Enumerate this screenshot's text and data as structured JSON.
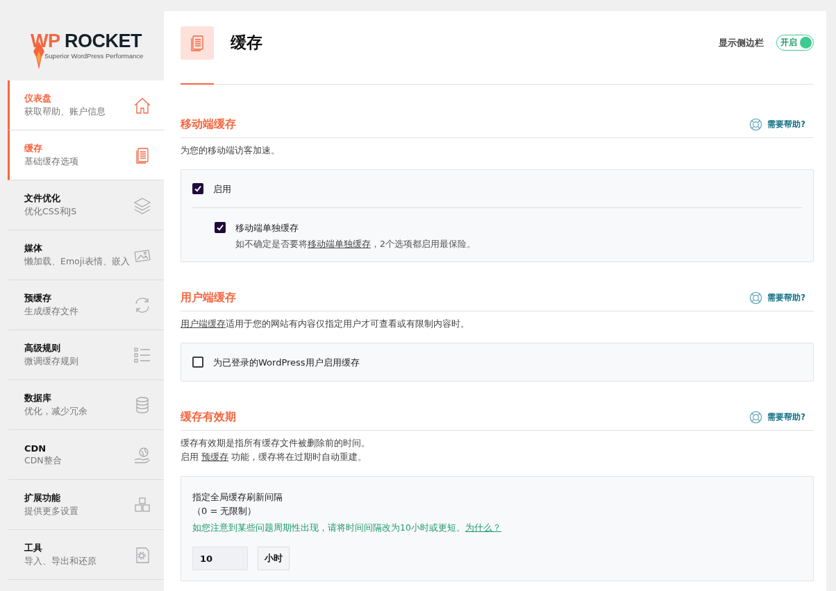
{
  "sidebar": {
    "logo": {
      "brand_left": "WP",
      "brand_right": "ROCKET",
      "tagline": "Superior WordPress Performance"
    },
    "items": [
      {
        "title": "仪表盘",
        "subtitle": "获取帮助、账户信息",
        "selected": true
      },
      {
        "title": "缓存",
        "subtitle": "基础缓存选项",
        "selected": true
      },
      {
        "title": "文件优化",
        "subtitle": "优化CSS和JS",
        "selected": false
      },
      {
        "title": "媒体",
        "subtitle": "懒加载、Emoji表情、嵌入",
        "selected": false
      },
      {
        "title": "预缓存",
        "subtitle": "生成缓存文件",
        "selected": false
      },
      {
        "title": "高级规则",
        "subtitle": "微调缓存规则",
        "selected": false
      },
      {
        "title": "数据库",
        "subtitle": "优化，减少冗余",
        "selected": false
      },
      {
        "title": "CDN",
        "subtitle": "CDN整合",
        "selected": false
      },
      {
        "title": "扩展功能",
        "subtitle": "提供更多设置",
        "selected": false
      },
      {
        "title": "工具",
        "subtitle": "导入、导出和还原",
        "selected": false
      }
    ]
  },
  "header": {
    "title": "缓存",
    "sidebar_toggle": {
      "label": "显示侧边栏",
      "state_text": "开启",
      "on": true
    }
  },
  "sections": [
    {
      "title": "移动端缓存",
      "help": "需要帮助?",
      "description": [
        {
          "before": "为您的移动端访客加速。"
        }
      ],
      "options": [
        {
          "kind": "checkbox",
          "label": "启用",
          "checked": true,
          "nested": false
        },
        {
          "kind": "checkbox",
          "label": "移动端单独缓存",
          "checked": true,
          "nested": true,
          "note": {
            "before": "如不确定是否要将",
            "link": "移动端单独缓存",
            "after": "，2个选项都启用最保险。"
          }
        }
      ]
    },
    {
      "title": "用户端缓存",
      "help": "需要帮助?",
      "description": [
        {
          "link": "用户端缓存",
          "after": "适用于您的网站有内容仅指定用户才可查看或有限制内容时。"
        }
      ],
      "options": [
        {
          "kind": "checkbox",
          "label": "为已登录的WordPress用户启用缓存",
          "checked": false,
          "nested": false
        }
      ]
    },
    {
      "title": "缓存有效期",
      "help": "需要帮助?",
      "description": [
        {
          "before": "缓存有效期是指所有缓存文件被删除前的时间。"
        },
        {
          "before": "启用 ",
          "link": "预缓存",
          "after": " 功能，缓存将在过期时自动重建。"
        }
      ],
      "options": [
        {
          "kind": "interval",
          "label": "指定全局缓存刷新间隔",
          "sublabel": "（0 = 无限制）",
          "hint": {
            "before": "如您注意到某些问题周期性出现，请将时间间隔改为10小时或更短。",
            "link": "为什么？"
          },
          "value": "10",
          "unit": "小时"
        }
      ]
    }
  ]
}
